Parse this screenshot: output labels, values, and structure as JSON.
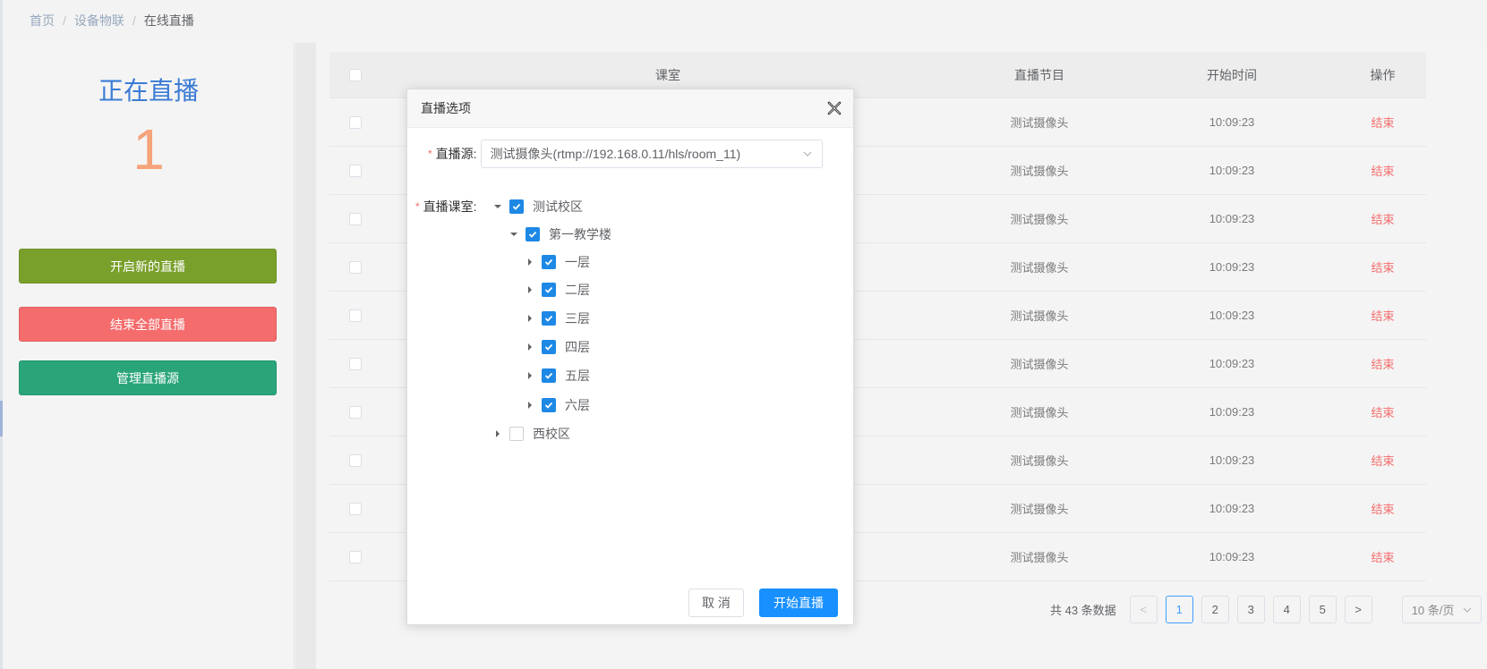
{
  "breadcrumb": {
    "home": "首页",
    "section": "设备物联",
    "current": "在线直播",
    "separator": "/"
  },
  "left_panel": {
    "title": "正在直播",
    "count": "1",
    "buttons": {
      "new_live": "开启新的直播",
      "end_all": "结束全部直播",
      "manage_sources": "管理直播源"
    }
  },
  "table": {
    "headers": {
      "room": "课室",
      "program": "直播节目",
      "start_time": "开始时间",
      "action": "操作"
    },
    "rows": [
      {
        "program": "测试摄像头",
        "time": "10:09:23",
        "action": "结束"
      },
      {
        "program": "测试摄像头",
        "time": "10:09:23",
        "action": "结束"
      },
      {
        "program": "测试摄像头",
        "time": "10:09:23",
        "action": "结束"
      },
      {
        "program": "测试摄像头",
        "time": "10:09:23",
        "action": "结束"
      },
      {
        "program": "测试摄像头",
        "time": "10:09:23",
        "action": "结束"
      },
      {
        "program": "测试摄像头",
        "time": "10:09:23",
        "action": "结束"
      },
      {
        "program": "测试摄像头",
        "time": "10:09:23",
        "action": "结束"
      },
      {
        "program": "测试摄像头",
        "time": "10:09:23",
        "action": "结束"
      },
      {
        "program": "测试摄像头",
        "time": "10:09:23",
        "action": "结束"
      },
      {
        "program": "测试摄像头",
        "time": "10:09:23",
        "action": "结束"
      }
    ]
  },
  "pagination": {
    "total_text": "共 43 条数据",
    "prev": "<",
    "next": ">",
    "pages": [
      "1",
      "2",
      "3",
      "4",
      "5"
    ],
    "current_page": "1",
    "page_size": "10 条/页"
  },
  "dialog": {
    "title": "直播选项",
    "required_mark": "*",
    "source_label": "直播源:",
    "source_value": "测试摄像头(rtmp://192.168.0.11/hls/room_11)",
    "room_label": "直播课室:",
    "tree": {
      "campus_test": {
        "label": "测试校区",
        "checked": true
      },
      "building_1": {
        "label": "第一教学楼",
        "checked": true
      },
      "floors": [
        {
          "label": "一层",
          "checked": true
        },
        {
          "label": "二层",
          "checked": true
        },
        {
          "label": "三层",
          "checked": true
        },
        {
          "label": "四层",
          "checked": true
        },
        {
          "label": "五层",
          "checked": true
        },
        {
          "label": "六层",
          "checked": true
        }
      ],
      "campus_west": {
        "label": "西校区",
        "checked": false
      }
    },
    "cancel": "取 消",
    "start": "开始直播"
  },
  "colors": {
    "accent": "#1890ff",
    "title_blue": "#3a7bd5",
    "count_orange": "#f5a37a",
    "btn_green": "#7aa02c",
    "btn_red": "#f56c6c",
    "btn_teal": "#2aa57a",
    "end_red": "#f56c6c"
  }
}
